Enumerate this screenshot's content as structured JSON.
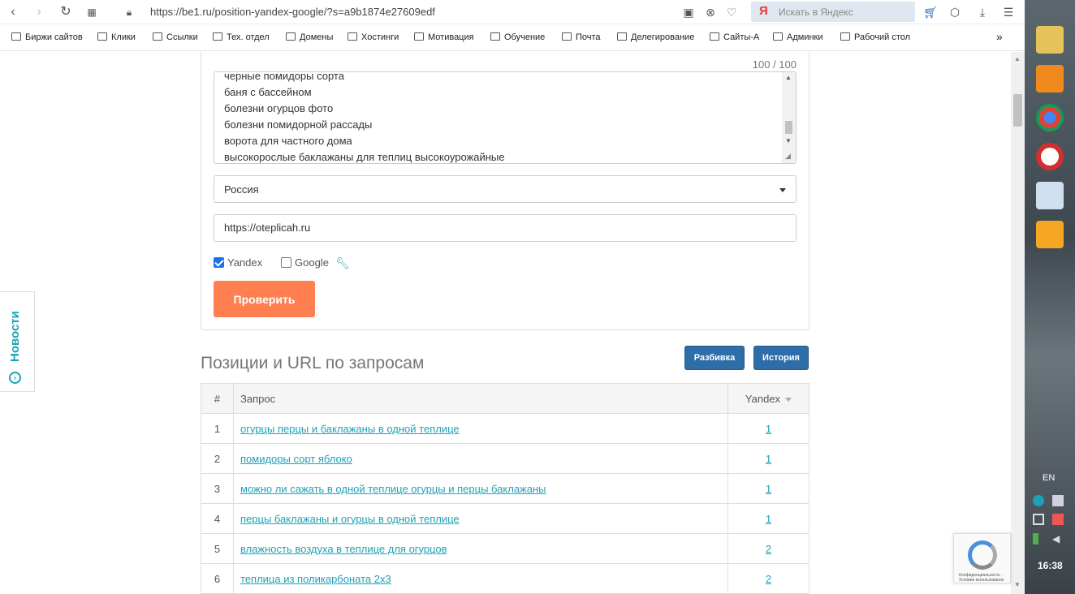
{
  "browser": {
    "url": "https://be1.ru/position-yandex-google/?s=a9b1874e27609edf",
    "search_placeholder": "Искать в Яндекс",
    "search_logo": "Я",
    "icons": [
      "back-icon",
      "forward-icon",
      "reload-icon",
      "grid-icon",
      "lock-icon",
      "camera-icon",
      "shield-icon",
      "heart-icon",
      "cart-icon",
      "box-icon",
      "download-icon",
      "menu-icon"
    ]
  },
  "bookmarks": [
    {
      "label": "Биржи сайтов"
    },
    {
      "label": "Клики"
    },
    {
      "label": "Ссылки"
    },
    {
      "label": "Тех. отдел"
    },
    {
      "label": "Домены"
    },
    {
      "label": "Хостинги"
    },
    {
      "label": "Мотивация"
    },
    {
      "label": "Обучение"
    },
    {
      "label": "Почта"
    },
    {
      "label": "Делегирование"
    },
    {
      "label": "Сайты-А"
    },
    {
      "label": "Админки"
    },
    {
      "label": "Рабочий стол"
    }
  ],
  "bookmarks_more": "»",
  "form": {
    "counter": "100 / 100",
    "queries": [
      "черные помидоры сорта",
      "баня с бассейном",
      "болезни огурцов фото",
      "болезни помидорной рассады",
      "ворота для частного дома",
      "высокорослые баклажаны для теплиц высокоурожайные"
    ],
    "region": "Россия",
    "site_url": "https://oteplicah.ru",
    "yandex_label": "Yandex",
    "yandex_checked": true,
    "google_label": "Google",
    "google_checked": false,
    "submit_label": "Проверить"
  },
  "results": {
    "title": "Позиции и URL по запросам",
    "breakdown_label": "Разбивка",
    "history_label": "История",
    "columns": {
      "num": "#",
      "query": "Запрос",
      "yandex": "Yandex"
    },
    "rows": [
      {
        "num": "1",
        "query": "огурцы перцы и баклажаны в одной теплице",
        "pos": "1"
      },
      {
        "num": "2",
        "query": "помидоры сорт яблоко",
        "pos": "1"
      },
      {
        "num": "3",
        "query": "можно ли сажать в одной теплице огурцы и перцы баклажаны",
        "pos": "1"
      },
      {
        "num": "4",
        "query": "перцы баклажаны и огурцы в одной теплице",
        "pos": "1"
      },
      {
        "num": "5",
        "query": "влажность воздуха в теплице для огурцов",
        "pos": "2"
      },
      {
        "num": "6",
        "query": "теплица из поликарбоната 2х3",
        "pos": "2"
      }
    ]
  },
  "news_tab": {
    "label": "Новости"
  },
  "recaptcha": {
    "text": "Конфиденциальность - Условия использования"
  },
  "taskbar": {
    "lang": "EN",
    "time": "16:38"
  },
  "colors": {
    "accent": "#ff7f50",
    "link": "#1aa3b8",
    "button_blue": "#2e6ea8"
  }
}
